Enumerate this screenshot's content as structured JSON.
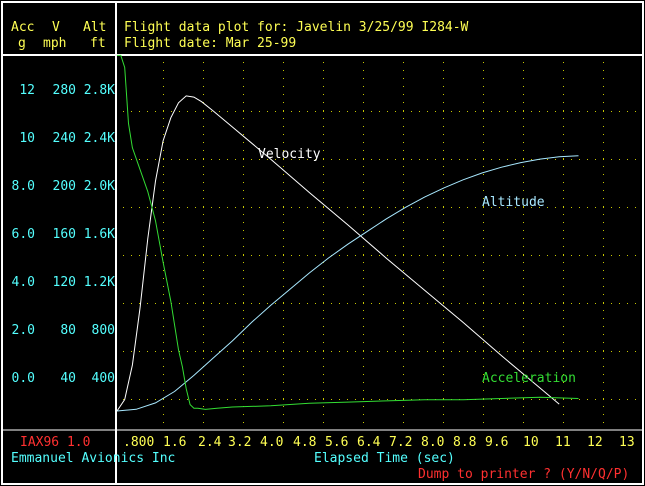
{
  "header": {
    "col_acc": "Acc",
    "col_v": "V",
    "col_alt": "Alt",
    "unit_acc": "g",
    "unit_v": "mph",
    "unit_alt": "ft",
    "title_line1": "Flight data plot for: Javelin 3/25/99 I284-W",
    "title_line2": "Flight date: Mar 25-99"
  },
  "footer": {
    "program": "IAX96 1.0",
    "company": "Emmanuel Avionics Inc",
    "x_axis_label": "Elapsed Time (sec)",
    "prompt": "Dump to printer ? (Y/N/Q/P)"
  },
  "colors": {
    "header_text": "#ffff54",
    "axis_labels": "#54ffff",
    "velocity": "#ffffff",
    "altitude": "#a8e8ff",
    "acceleration": "#33dd33",
    "red_text": "#ff3030",
    "grid_dots": "#c8c800"
  },
  "chart_data": {
    "type": "line",
    "title": "Flight data plot for: Javelin 3/25/99 I284-W",
    "xlabel": "Elapsed Time (sec)",
    "xlim": [
      0,
      13.6
    ],
    "x_ticks": [
      ".800",
      "1.6",
      "2.4",
      "3.2",
      "4.0",
      "4.8",
      "5.6",
      "6.4",
      "7.2",
      "8.0",
      "8.8",
      "9.6",
      "10",
      "11",
      "12",
      "13"
    ],
    "y_axes": {
      "acc": {
        "unit": "g",
        "ticks": [
          "12",
          "10",
          "8.0",
          "6.0",
          "4.0",
          "2.0",
          "0.0"
        ]
      },
      "velocity": {
        "unit": "mph",
        "ticks": [
          "280",
          "240",
          "200",
          "160",
          "120",
          "80",
          "40"
        ]
      },
      "altitude": {
        "unit": "ft",
        "ticks": [
          "2.8K",
          "2.4K",
          "2.0K",
          "1.6K",
          "1.2K",
          "800",
          "400"
        ]
      }
    },
    "grid": true,
    "series": [
      {
        "name": "Velocity",
        "axis": "velocity",
        "x": [
          0,
          0.2,
          0.4,
          0.6,
          0.8,
          1.0,
          1.2,
          1.4,
          1.6,
          1.8,
          2.0,
          2.2,
          2.5,
          3.0,
          4.0,
          5.0,
          6.0,
          7.0,
          8.0,
          9.0,
          10.0,
          10.5,
          11.0,
          11.5
        ],
        "values": [
          0,
          10,
          40,
          90,
          150,
          200,
          235,
          255,
          268,
          274,
          273,
          269,
          261,
          247,
          219,
          190,
          162,
          133,
          105,
          77,
          48,
          34,
          20,
          6
        ]
      },
      {
        "name": "Altitude",
        "axis": "altitude",
        "x": [
          0,
          0.5,
          1.0,
          1.5,
          2.0,
          2.5,
          3.0,
          3.5,
          4.0,
          4.5,
          5.0,
          5.5,
          6.0,
          6.5,
          7.0,
          7.5,
          8.0,
          8.5,
          9.0,
          9.5,
          10.0,
          10.5,
          11.0,
          11.5,
          12.0
        ],
        "values": [
          0,
          15,
          70,
          170,
          310,
          460,
          610,
          770,
          920,
          1060,
          1200,
          1330,
          1450,
          1560,
          1670,
          1770,
          1860,
          1940,
          2010,
          2070,
          2120,
          2160,
          2190,
          2210,
          2220
        ]
      },
      {
        "name": "Acceleration",
        "axis": "acc",
        "x": [
          0,
          0.1,
          0.2,
          0.3,
          0.4,
          0.6,
          0.8,
          1.0,
          1.2,
          1.4,
          1.6,
          1.7,
          1.8,
          1.9,
          2.0,
          2.1,
          2.3,
          2.6,
          3.0,
          4.0,
          5.0,
          6.0,
          7.0,
          8.0,
          9.0,
          10.0,
          11.0,
          12.0
        ],
        "values": [
          13.3,
          13.3,
          12.8,
          10.5,
          9.5,
          8.6,
          7.7,
          6.5,
          4.8,
          3.2,
          1.2,
          0.5,
          -0.4,
          -1.05,
          -1.2,
          -1.2,
          -1.25,
          -1.2,
          -1.15,
          -1.1,
          -1.0,
          -0.95,
          -0.9,
          -0.85,
          -0.85,
          -0.8,
          -0.75,
          -0.8
        ]
      }
    ]
  }
}
